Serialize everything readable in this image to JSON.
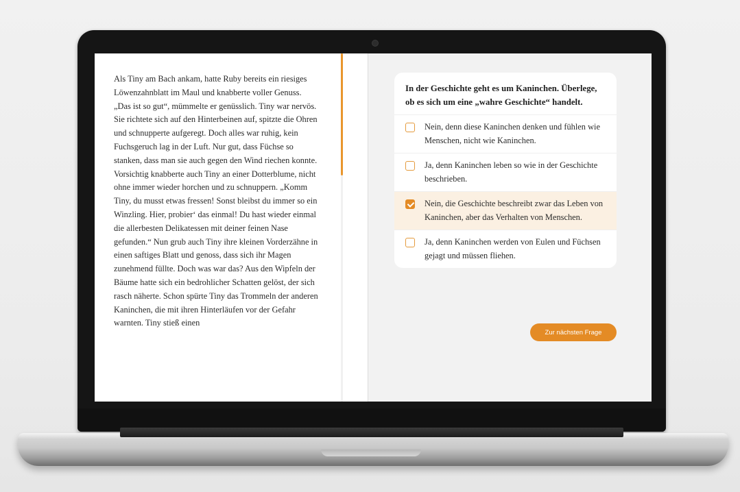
{
  "reading": {
    "text": "Als Tiny am Bach ankam, hatte Ruby bereits ein riesiges Löwenzahnblatt im Maul und knabberte voller Genuss. „Das ist so gut“, mümmelte er genüsslich. Tiny war nervös. Sie richtete sich auf den Hinterbeinen auf, spitzte die Ohren und schnupperte aufgeregt. Doch alles war ruhig, kein Fuchsgeruch lag in der Luft. Nur gut, dass Füchse so stanken, dass man sie auch gegen den Wind riechen konnte. Vorsichtig knabberte auch Tiny an einer Dotterblume, nicht ohne immer wieder horchen und zu schnuppern. „Komm Tiny, du musst etwas fressen! Sonst bleibst du immer so ein Winzling. Hier, probier‘ das einmal! Du hast wieder einmal die allerbesten Delikatessen mit deiner feinen Nase gefunden.“ Nun grub auch Tiny ihre kleinen Vorderzähne in einen saftiges Blatt und genoss, dass sich ihr Magen zunehmend füllte. Doch was war das? Aus den Wipfeln der Bäume hatte sich ein bedrohlicher Schatten gelöst, der sich rasch näherte. Schon spürte Tiny das Trommeln der anderen Kaninchen, die mit ihren Hinterläufen vor der Gefahr warnten. Tiny stieß einen",
    "scroll_progress": 0.35
  },
  "quiz": {
    "question": "In der Geschichte geht es um Kaninchen. Überlege, ob es sich um eine „wahre Geschichte“ handelt.",
    "options": [
      {
        "label": "Nein, denn diese Kaninchen denken und fühlen wie Menschen, nicht wie Kaninchen.",
        "checked": false
      },
      {
        "label": "Ja, denn Kaninchen leben so wie in der Geschichte beschrieben.",
        "checked": false
      },
      {
        "label": "Nein, die Geschichte beschreibt zwar das Leben von Kaninchen, aber das Verhalten von Menschen.",
        "checked": true
      },
      {
        "label": "Ja, denn Kaninchen werden von Eulen und Füchsen gejagt und müssen fliehen.",
        "checked": false
      }
    ],
    "next_label": "Zur nächsten Frage"
  },
  "colors": {
    "accent": "#e48b25",
    "selected_bg": "#fbf0e2",
    "pane_bg": "#f2f2f2"
  }
}
